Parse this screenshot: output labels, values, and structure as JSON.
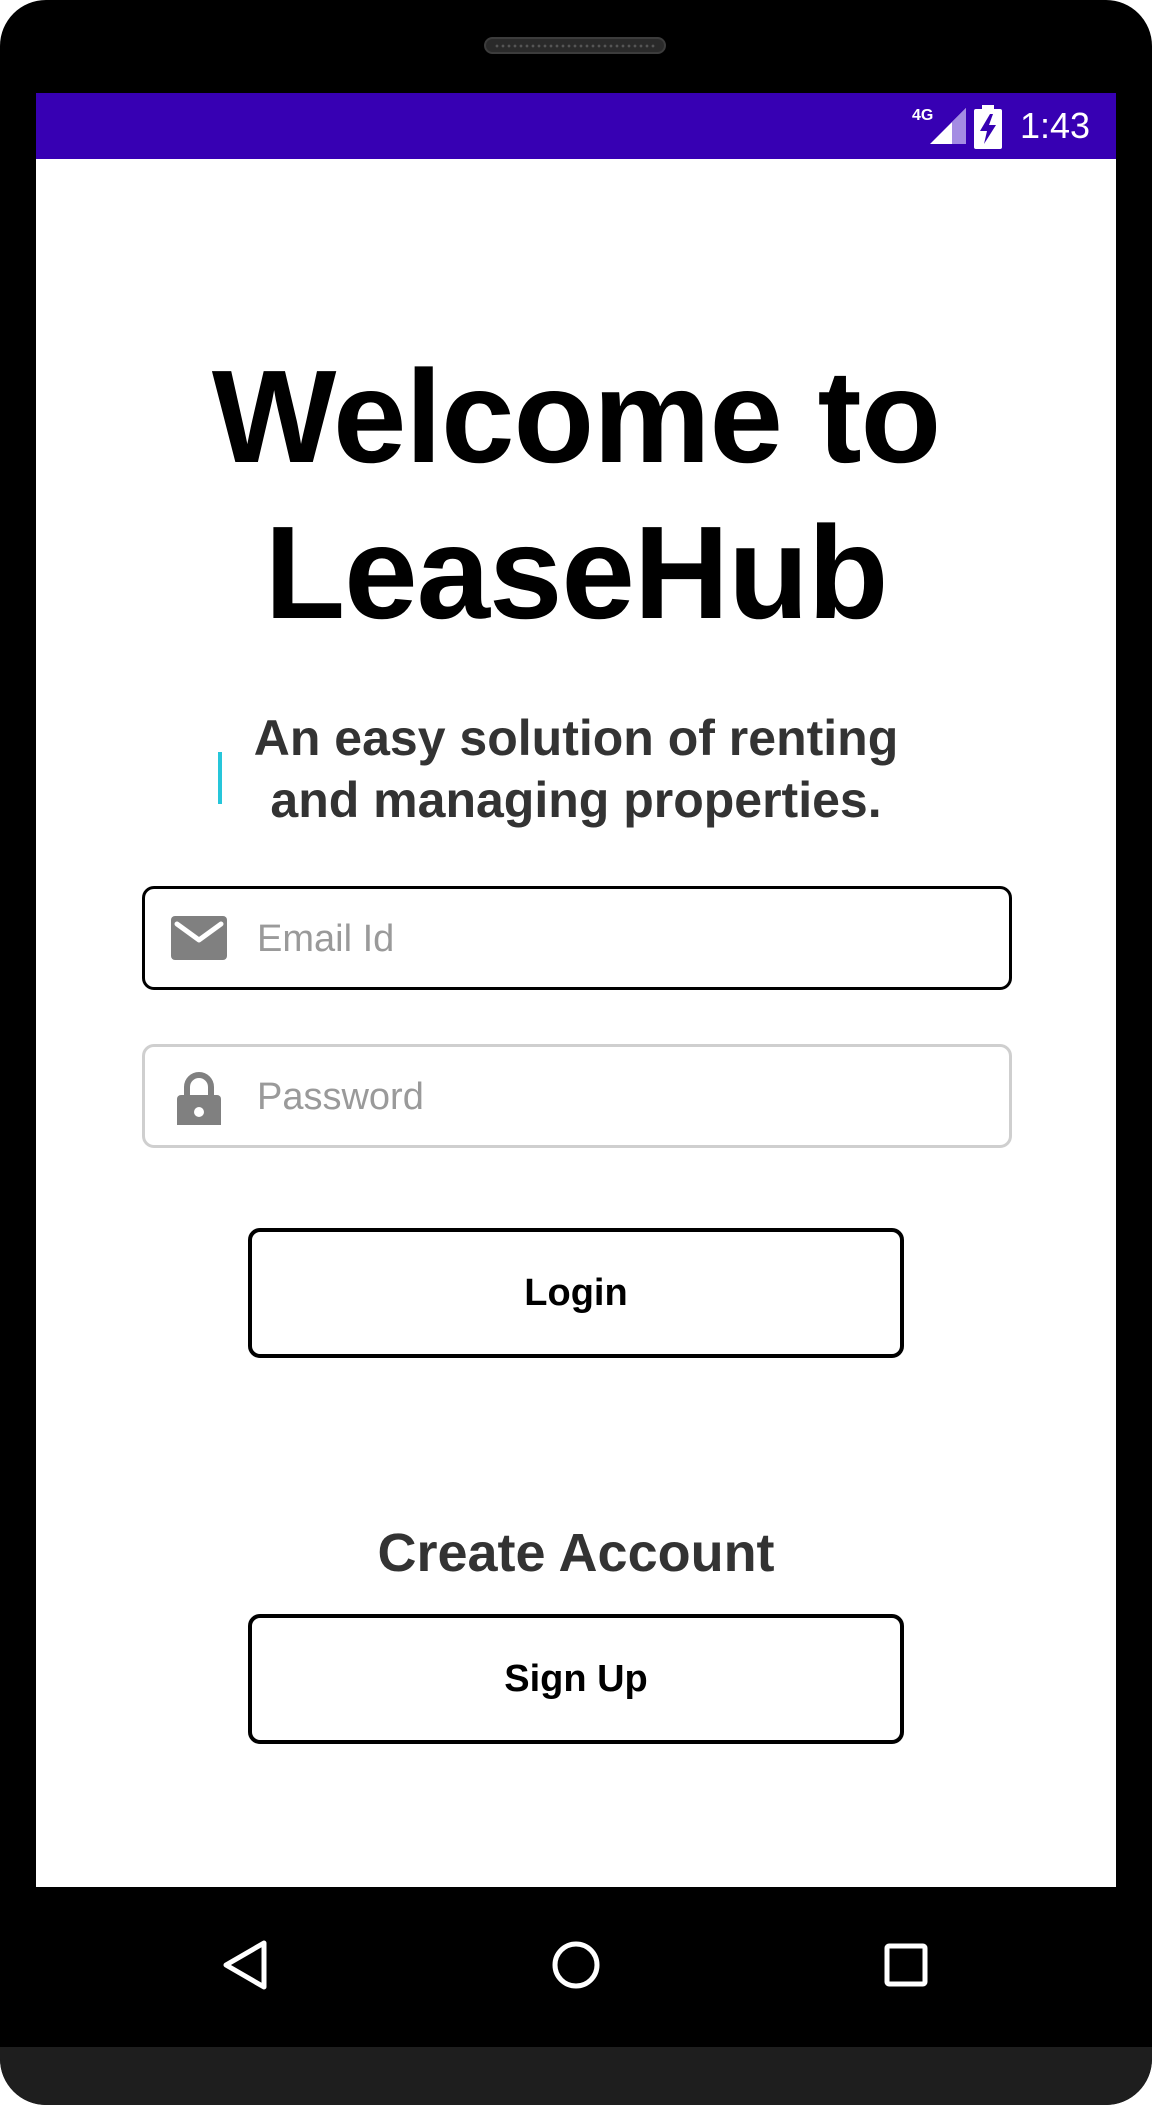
{
  "status_bar": {
    "network": "4G",
    "time": "1:43",
    "background_color": "#3700b3"
  },
  "welcome": {
    "title_line1": "Welcome to",
    "title_line2": "LeaseHub",
    "subtitle_line1": "An easy solution of renting",
    "subtitle_line2": "and managing properties."
  },
  "login_form": {
    "email": {
      "placeholder": "Email Id",
      "value": "",
      "icon": "email-icon"
    },
    "password": {
      "placeholder": "Password",
      "value": "",
      "icon": "lock-icon"
    },
    "login_label": "Login"
  },
  "signup": {
    "heading": "Create Account",
    "button_label": "Sign Up"
  },
  "nav": {
    "back_icon": "back-triangle-icon",
    "home_icon": "home-circle-icon",
    "recents_icon": "recents-square-icon"
  },
  "colors": {
    "accent": "#3700b3",
    "caret": "#26c6da",
    "icon_gray": "#808080"
  }
}
